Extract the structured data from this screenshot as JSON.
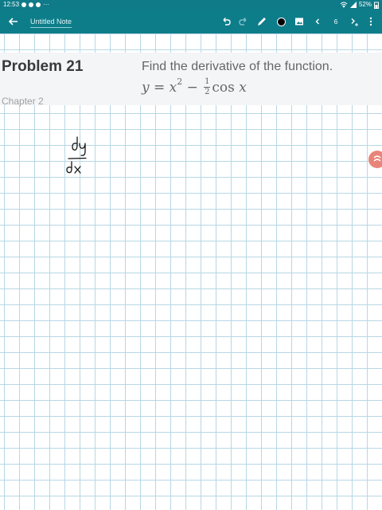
{
  "status_bar": {
    "time": "12:53",
    "more": "···",
    "battery": "52%"
  },
  "app_bar": {
    "note_title": "Untitled Note",
    "page_number": "6"
  },
  "problem": {
    "title": "Problem 21",
    "chapter": "Chapter 2",
    "statement": "Find the derivative of the function.",
    "formula": {
      "lhs": "y = x",
      "exp": "2",
      "minus": " − ",
      "frac_num": "1",
      "frac_den": "2",
      "func": "cos",
      "var": " x"
    }
  },
  "handwriting": {
    "numerator": "dy",
    "denominator": "dx"
  },
  "colors": {
    "app_bar": "#0e7d8a",
    "grid_line": "#b7d7e6",
    "panel": "#f4f5f7",
    "side_button": "#e8857a"
  }
}
